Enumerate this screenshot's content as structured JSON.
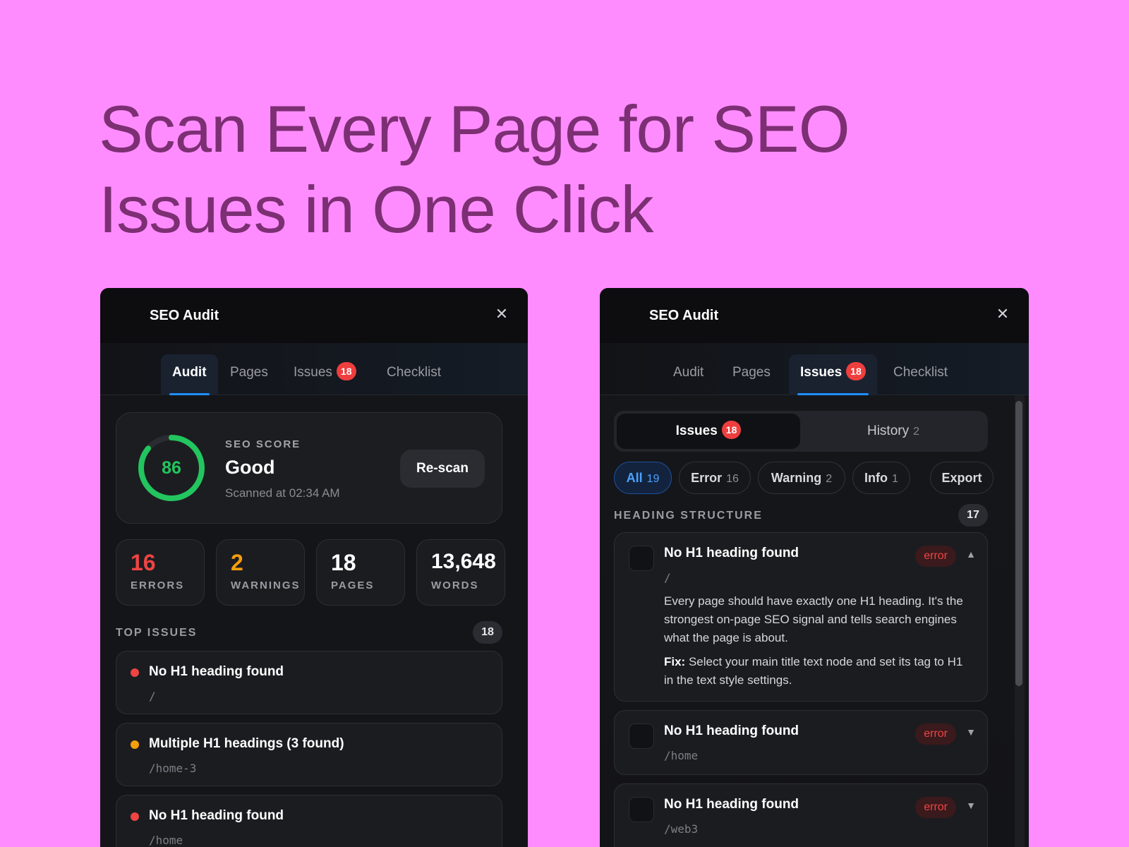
{
  "headline": {
    "line1": "Scan Every Page for SEO",
    "line2": "Issues in One Click"
  },
  "colors": {
    "background": "#ff8cff",
    "headline": "#7c2f73",
    "accent": "#1e8fff",
    "success": "#22c55e",
    "error": "#ef4444",
    "warning": "#f59e0b"
  },
  "left_panel": {
    "title": "SEO Audit",
    "close_icon": "close-icon",
    "tabs": [
      {
        "label": "Audit",
        "active": true
      },
      {
        "label": "Pages"
      },
      {
        "label": "Issues",
        "badge": "18"
      },
      {
        "label": "Checklist"
      }
    ],
    "score": {
      "label": "SEO SCORE",
      "value": 86,
      "value_text": "86",
      "status": "Good",
      "scanned": "Scanned at 02:34 AM",
      "rescan_label": "Re-scan"
    },
    "stats": [
      {
        "value": "16",
        "label": "ERRORS",
        "color": "#ef4444"
      },
      {
        "value": "2",
        "label": "WARNINGS",
        "color": "#f59e0b"
      },
      {
        "value": "18",
        "label": "PAGES",
        "color": "#ffffff"
      },
      {
        "value": "13,648",
        "label": "WORDS",
        "color": "#ffffff"
      }
    ],
    "top_issues": {
      "heading": "TOP ISSUES",
      "count": "18",
      "items": [
        {
          "title": "No H1 heading found",
          "path": "/",
          "severity": "error"
        },
        {
          "title": "Multiple H1 headings (3 found)",
          "path": "/home-3",
          "severity": "warning"
        },
        {
          "title": "No H1 heading found",
          "path": "/home",
          "severity": "error"
        }
      ]
    }
  },
  "right_panel": {
    "title": "SEO Audit",
    "tabs": [
      {
        "label": "Audit"
      },
      {
        "label": "Pages"
      },
      {
        "label": "Issues",
        "badge": "18",
        "active": true
      },
      {
        "label": "Checklist"
      }
    ],
    "segmented": {
      "issues_label": "Issues",
      "issues_badge": "18",
      "history_label": "History",
      "history_count": "2"
    },
    "filters": [
      {
        "label": "All",
        "count": "19",
        "active": true
      },
      {
        "label": "Error",
        "count": "16"
      },
      {
        "label": "Warning",
        "count": "2"
      },
      {
        "label": "Info",
        "count": "1"
      }
    ],
    "export_label": "Export",
    "section": {
      "heading": "HEADING STRUCTURE",
      "count": "17"
    },
    "issues": [
      {
        "title": "No H1 heading found",
        "path": "/",
        "severity": "error",
        "expanded": true,
        "description": "Every page should have exactly one H1 heading. It's the strongest on-page SEO signal and tells search engines what the page is about.",
        "fix_label": "Fix:",
        "fix_text": " Select your main title text node and set its tag to H1 in the text style settings."
      },
      {
        "title": "No H1 heading found",
        "path": "/home",
        "severity": "error",
        "expanded": false
      },
      {
        "title": "No H1 heading found",
        "path": "/web3",
        "severity": "error",
        "expanded": false
      }
    ],
    "chevron_up": "▲",
    "chevron_down": "▼"
  }
}
